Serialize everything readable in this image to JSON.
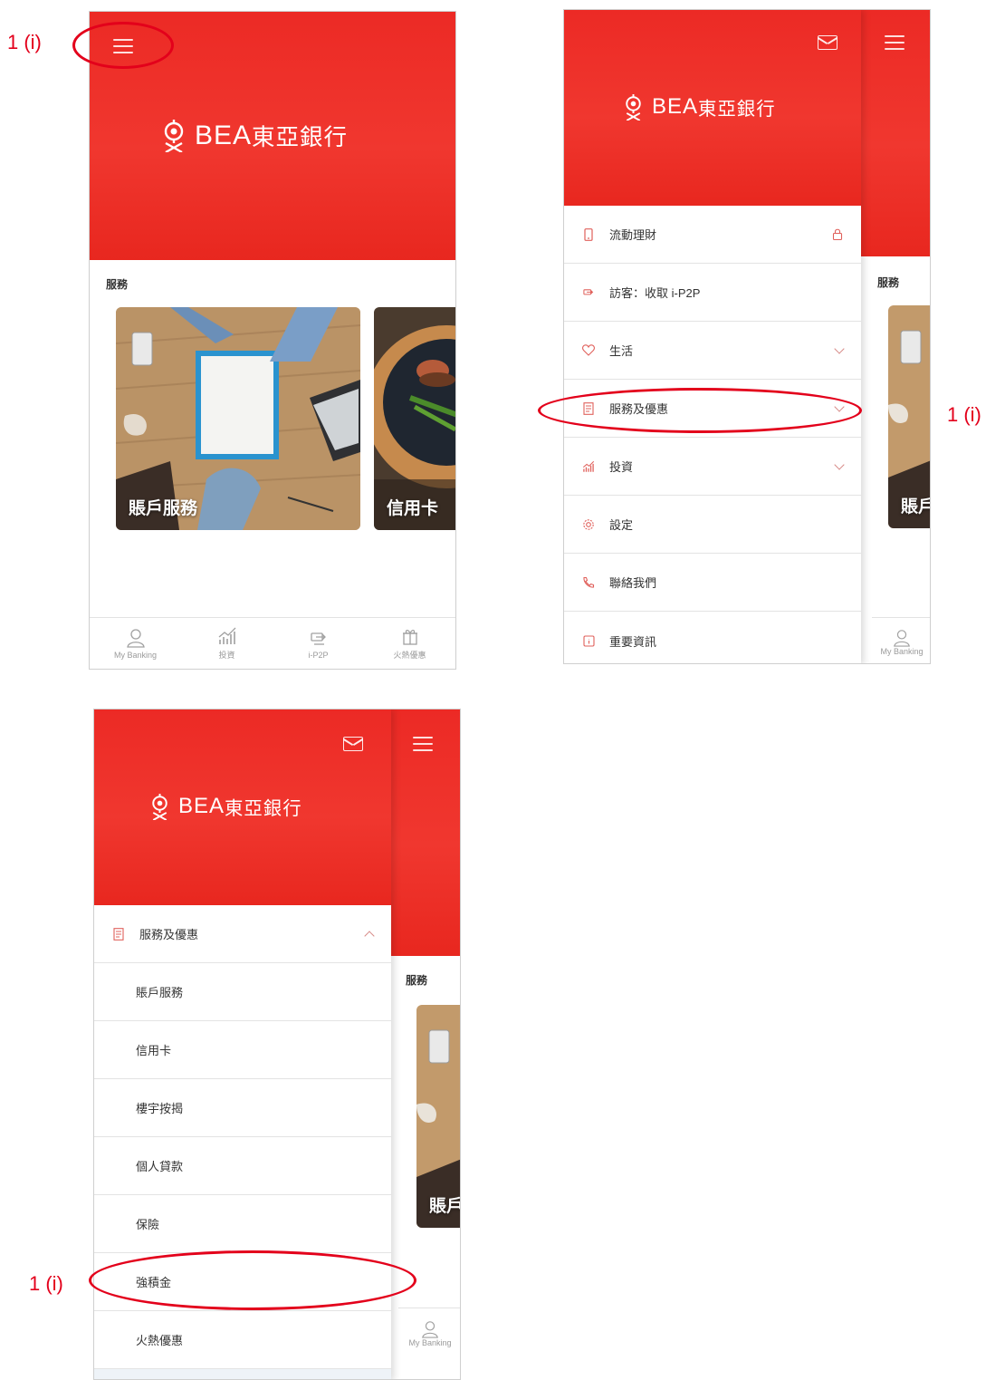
{
  "brand": {
    "name_en": "BEA",
    "name_zh": "東亞銀行"
  },
  "annotation_label": "1 (i)",
  "home": {
    "section_title": "服務",
    "cards": [
      {
        "caption": "賬戶服務"
      },
      {
        "caption": "信用卡"
      }
    ],
    "tabs": [
      {
        "label": "My Banking",
        "icon": "user-icon"
      },
      {
        "label": "投資",
        "icon": "chart-icon"
      },
      {
        "label": "i-P2P",
        "icon": "p2p-icon"
      },
      {
        "label": "火熱優惠",
        "icon": "gift-icon"
      }
    ]
  },
  "menu": {
    "items": [
      {
        "label": "流動理財",
        "icon": "mobile-icon",
        "trail": "lock"
      },
      {
        "label": "訪客：收取 i-P2P",
        "icon": "p2p-icon",
        "trail": ""
      },
      {
        "label": "生活",
        "icon": "heart-icon",
        "trail": "chevron"
      },
      {
        "label": "服務及優惠",
        "icon": "document-icon",
        "trail": "chevron"
      },
      {
        "label": "投資",
        "icon": "chart-icon",
        "trail": "chevron"
      },
      {
        "label": "設定",
        "icon": "gear-icon",
        "trail": ""
      },
      {
        "label": "聯絡我們",
        "icon": "phone-icon",
        "trail": ""
      },
      {
        "label": "重要資訊",
        "icon": "info-icon",
        "trail": ""
      }
    ],
    "peek_section": "服務",
    "peek_card": "賬戶",
    "peek_tab": "My Banking"
  },
  "submenu": {
    "header": "服務及優惠",
    "items": [
      "賬戶服務",
      "信用卡",
      "樓宇按揭",
      "個人貸款",
      "保險",
      "強積金",
      "火熱優惠"
    ]
  },
  "colors": {
    "brand_red": "#ec2a25",
    "annotation_red": "#e3001b"
  }
}
